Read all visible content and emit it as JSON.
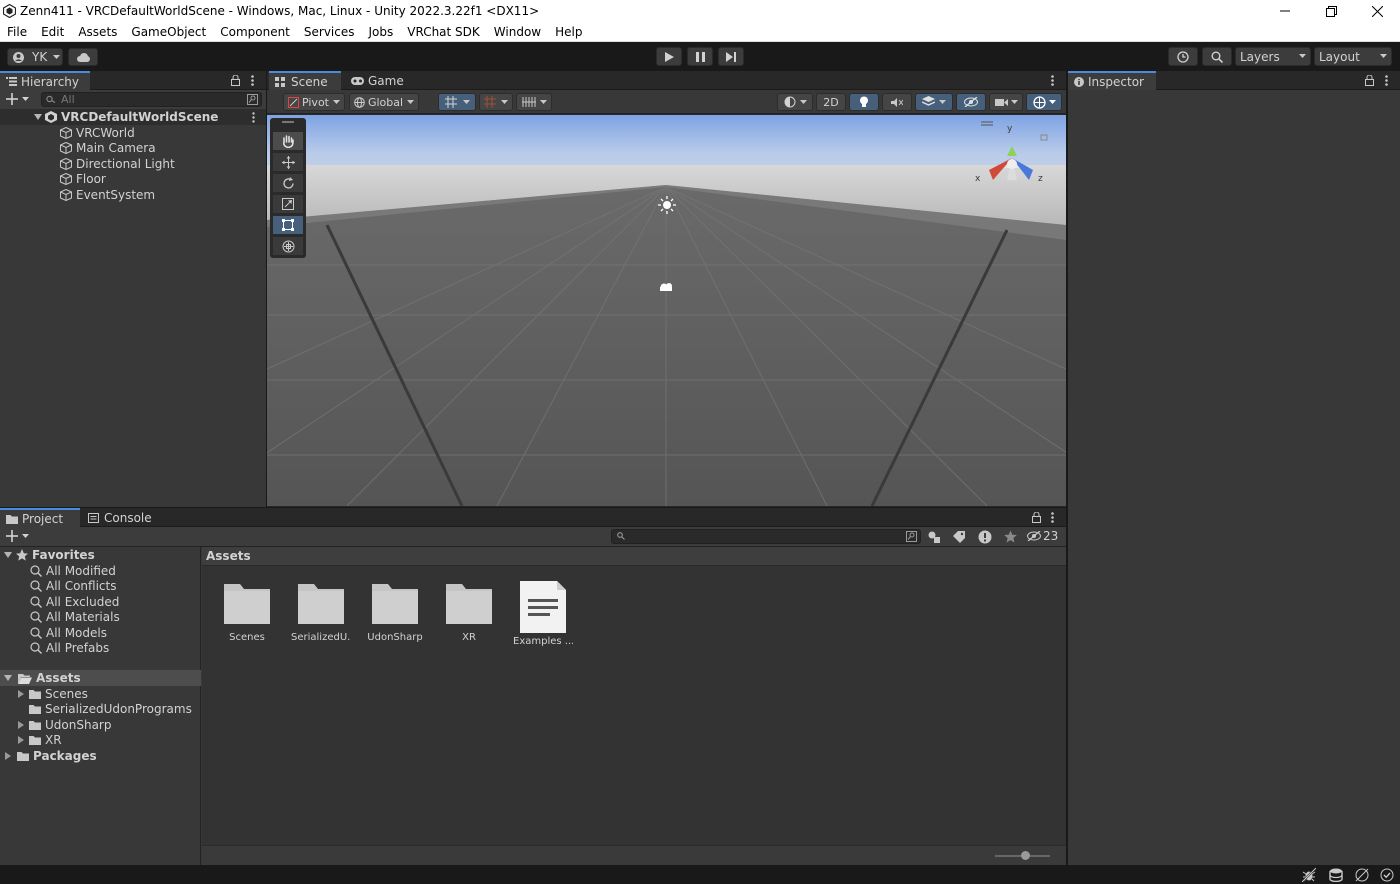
{
  "window": {
    "title": "Zenn411 - VRCDefaultWorldScene - Windows, Mac, Linux - Unity 2022.3.22f1 <DX11>",
    "controls": [
      "minimize",
      "restore",
      "close"
    ]
  },
  "menu": [
    "File",
    "Edit",
    "Assets",
    "GameObject",
    "Component",
    "Services",
    "Jobs",
    "VRChat SDK",
    "Window",
    "Help"
  ],
  "toolbar": {
    "account": "YK",
    "layers_label": "Layers",
    "layout_label": "Layout"
  },
  "hierarchy": {
    "tab_label": "Hierarchy",
    "search_placeholder": "All",
    "scene_name": "VRCDefaultWorldScene",
    "items": [
      "VRCWorld",
      "Main Camera",
      "Directional Light",
      "Floor",
      "EventSystem"
    ]
  },
  "scene_view": {
    "tabs": [
      "Scene",
      "Game"
    ],
    "pivot_label": "Pivot",
    "global_label": "Global",
    "mode_2d": "2D",
    "gizmo_axes": {
      "y": "y",
      "x": "x",
      "z": "z"
    }
  },
  "inspector": {
    "tab_label": "Inspector"
  },
  "project": {
    "tabs": [
      "Project",
      "Console"
    ],
    "hidden_count": "23",
    "favorites_label": "Favorites",
    "favorites": [
      "All Modified",
      "All Conflicts",
      "All Excluded",
      "All Materials",
      "All Models",
      "All Prefabs"
    ],
    "assets_label": "Assets",
    "asset_tree": [
      "Scenes",
      "SerializedUdonPrograms",
      "UdonSharp",
      "XR"
    ],
    "packages_label": "Packages",
    "breadcrumb": "Assets",
    "grid_items": [
      {
        "name": "Scenes",
        "kind": "folder"
      },
      {
        "name": "SerializedU...",
        "kind": "folder"
      },
      {
        "name": "UdonSharp",
        "kind": "folder"
      },
      {
        "name": "XR",
        "kind": "folder"
      },
      {
        "name": "Examples ...",
        "kind": "file"
      }
    ]
  },
  "colors": {
    "accent": "#4a8cdb",
    "panel": "#383838",
    "header": "#282828",
    "sky_top": "#86a9e6"
  }
}
